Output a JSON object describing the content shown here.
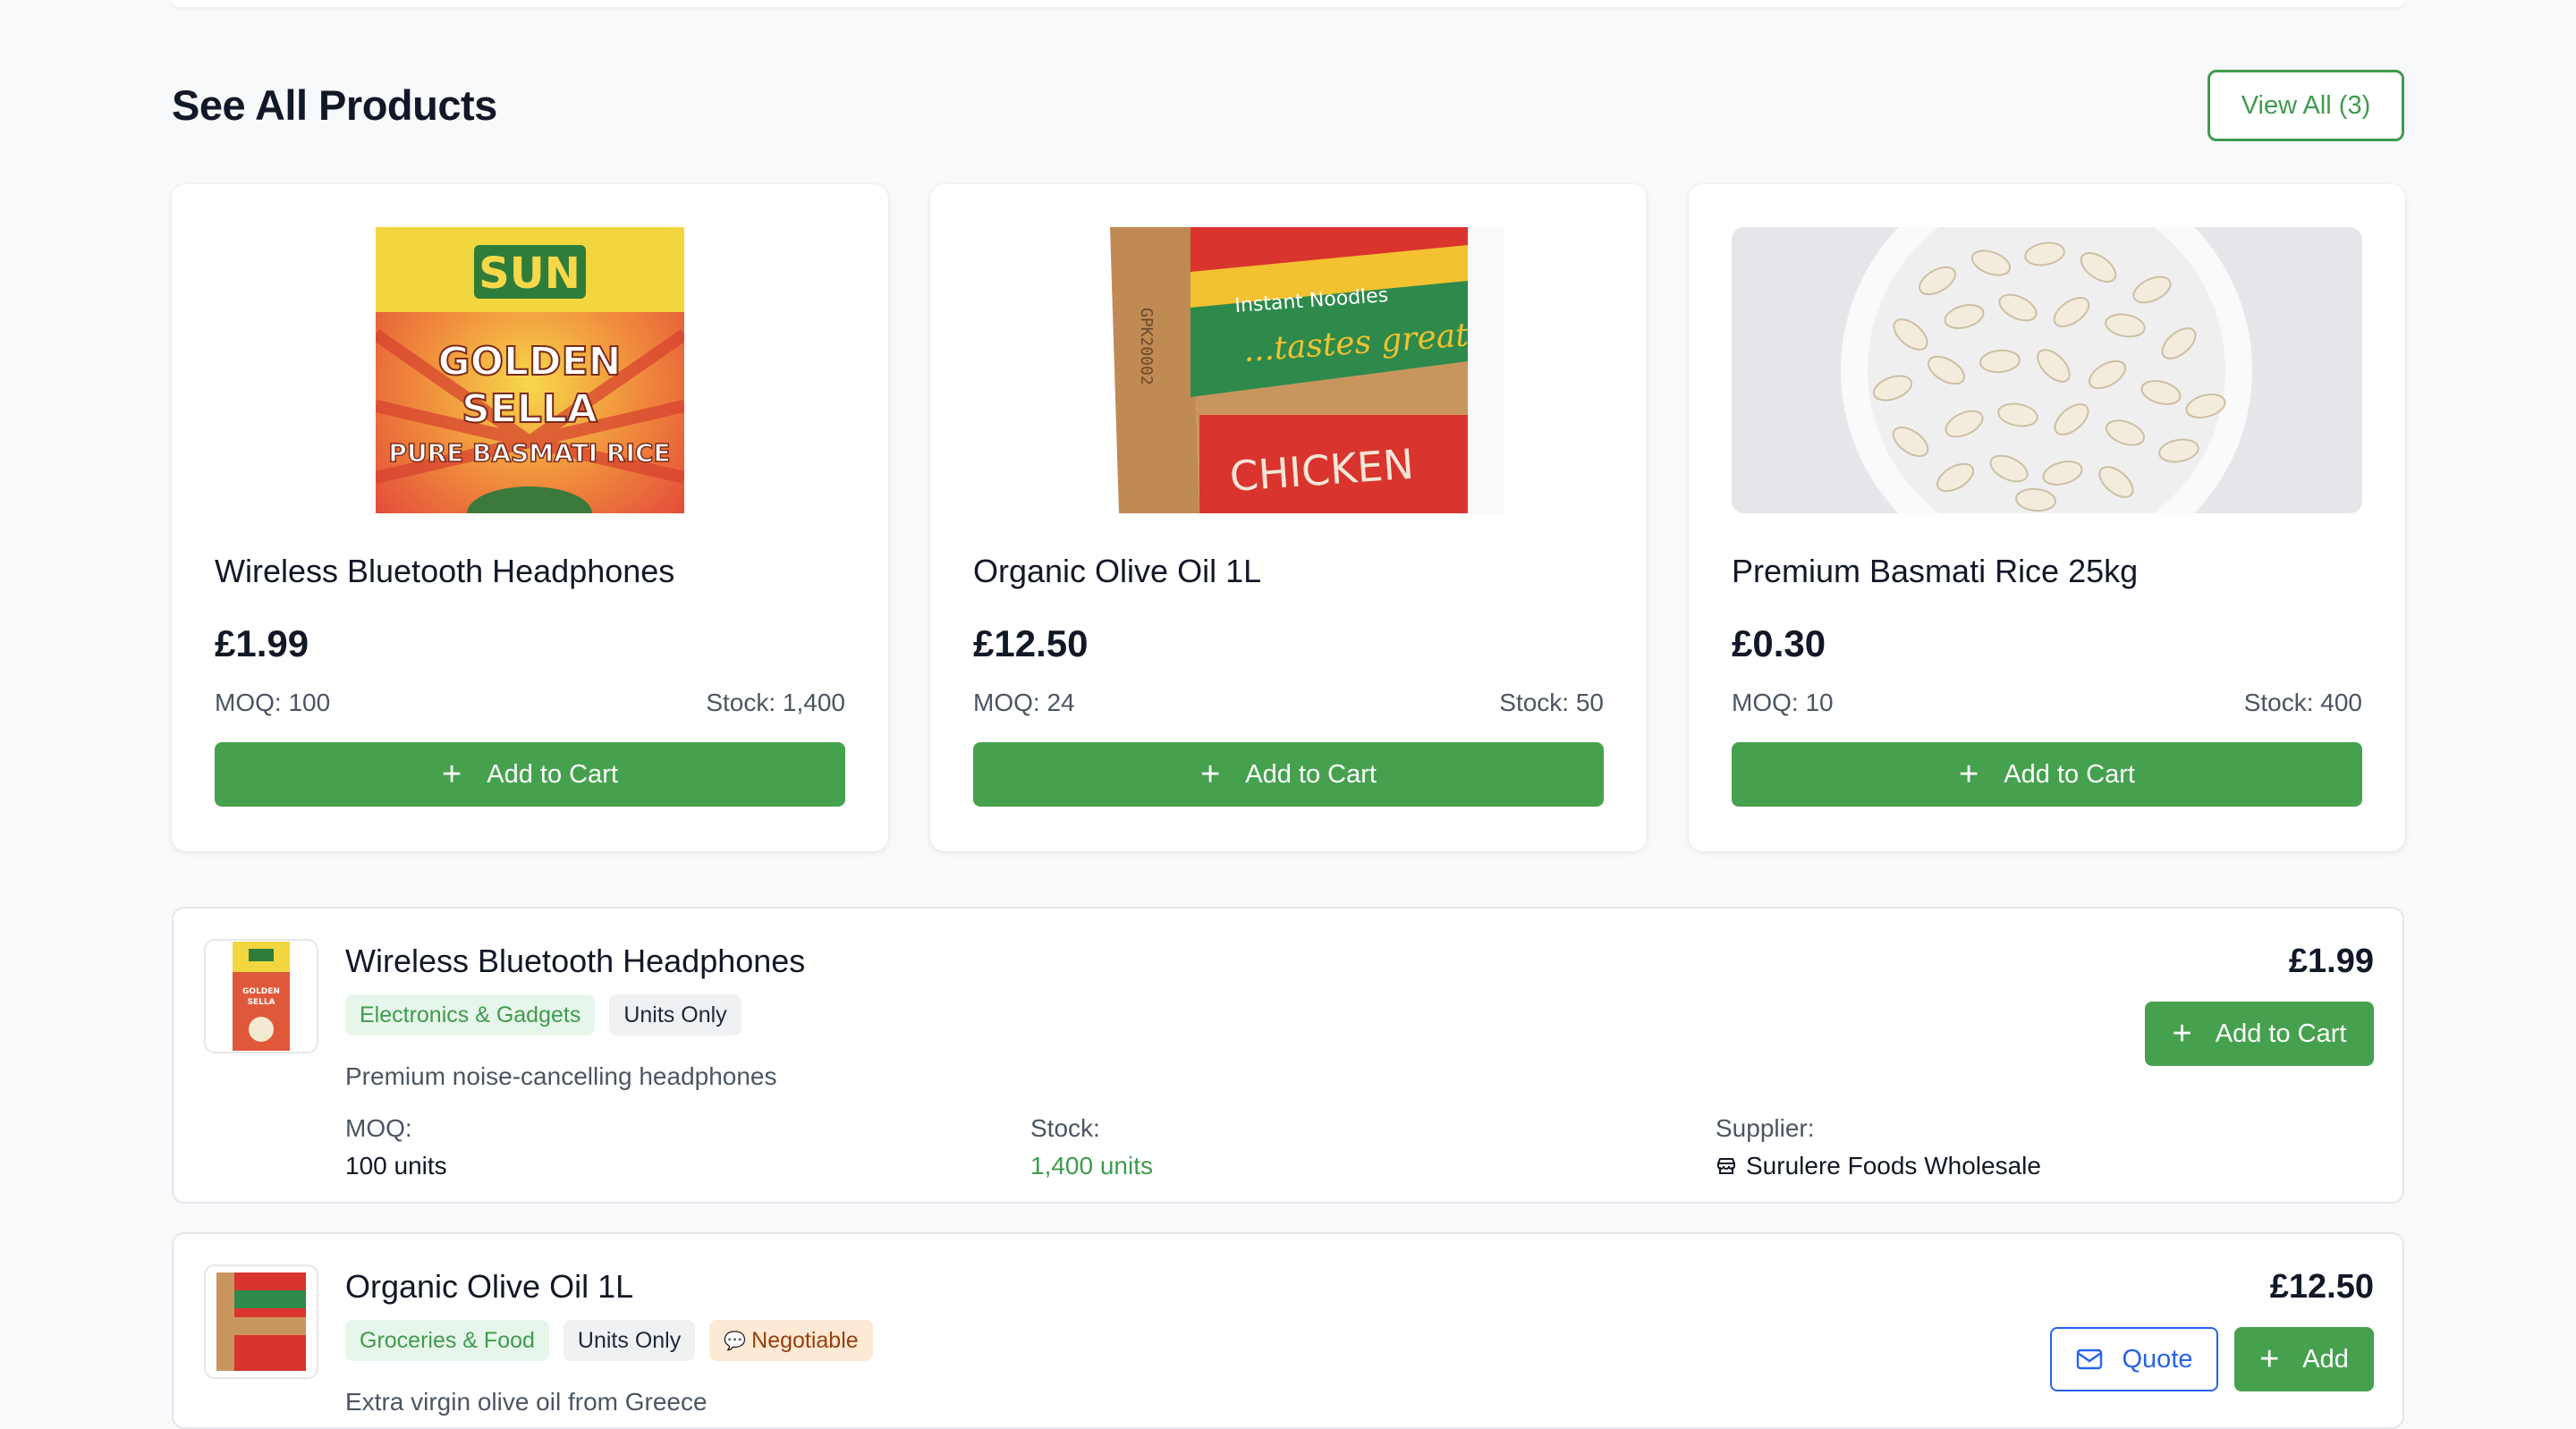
{
  "section": {
    "title": "See All Products",
    "view_all": "View All (3)"
  },
  "cards": [
    {
      "name": "Wireless Bluetooth Headphones",
      "price": "£1.99",
      "moq": "MOQ: 100",
      "stock": "Stock: 1,400",
      "button": "Add to Cart",
      "image_icon": "rice-bag-image"
    },
    {
      "name": "Organic Olive Oil 1L",
      "price": "£12.50",
      "moq": "MOQ: 24",
      "stock": "Stock: 50",
      "button": "Add to Cart",
      "image_icon": "noodles-box-image"
    },
    {
      "name": "Premium Basmati Rice 25kg",
      "price": "£0.30",
      "moq": "MOQ: 10",
      "stock": "Stock: 400",
      "button": "Add to Cart",
      "image_icon": "beans-bowl-image"
    }
  ],
  "list": [
    {
      "title": "Wireless Bluetooth Headphones",
      "category": "Electronics & Gadgets",
      "unit_tag": "Units Only",
      "description": "Premium noise-cancelling headphones",
      "price": "£1.99",
      "add_label": "Add to Cart",
      "moq_label": "MOQ:",
      "moq_value": "100 units",
      "stock_label": "Stock:",
      "stock_value": "1,400 units",
      "supplier_label": "Supplier:",
      "supplier_value": "Surulere Foods Wholesale"
    },
    {
      "title": "Organic Olive Oil 1L",
      "category": "Groceries & Food",
      "unit_tag": "Units Only",
      "negotiable_tag": "Negotiable",
      "description": "Extra virgin olive oil from Greece",
      "price": "£12.50",
      "quote_label": "Quote",
      "add_label": "Add"
    }
  ],
  "colors": {
    "brand_green": "#46a14f",
    "quote_blue": "#2563eb",
    "background": "#f8f9fb"
  }
}
